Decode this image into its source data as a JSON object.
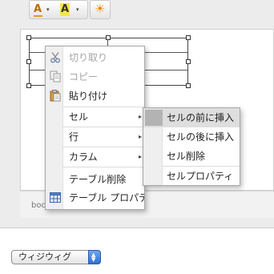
{
  "toolbar": {
    "font_color_glyph": "A",
    "highlight_glyph": "A",
    "sun_glyph": "☀",
    "dropdown_glyph": "▾"
  },
  "icons": [
    "scissors-icon",
    "copy-icon",
    "paste-icon",
    "table-icon"
  ],
  "context_menu": {
    "items": [
      {
        "label": "切り取り",
        "enabled": false,
        "icon": "scissors-icon"
      },
      {
        "label": "コピー",
        "enabled": false,
        "icon": "copy-icon"
      },
      {
        "label": "貼り付け",
        "enabled": true,
        "icon": "paste-icon"
      },
      {
        "label": "セル",
        "submenu": true
      },
      {
        "label": "行",
        "submenu": true
      },
      {
        "label": "カラム",
        "submenu": true
      },
      {
        "label": "テーブル削除"
      },
      {
        "label": "テーブル プロパテ",
        "icon": "table-icon"
      }
    ],
    "arrow": "▸"
  },
  "submenu": {
    "items": [
      {
        "label": "セルの前に挿入",
        "highlighted": true
      },
      {
        "label": "セルの後に挿入"
      },
      {
        "label": "セル削除"
      },
      {
        "label": "セルプロパティ"
      }
    ]
  },
  "status_bar": {
    "path": "body"
  },
  "mode_select": {
    "value": "ウィジウィグ",
    "up_arrow": "▲",
    "down_arrow": "▼"
  },
  "colors": {
    "highlight_yellow": "#f5e64a",
    "font_color_orange": "#c06a00",
    "sun_orange": "#f08a0a",
    "stepper_blue": "#2f6fd6"
  }
}
